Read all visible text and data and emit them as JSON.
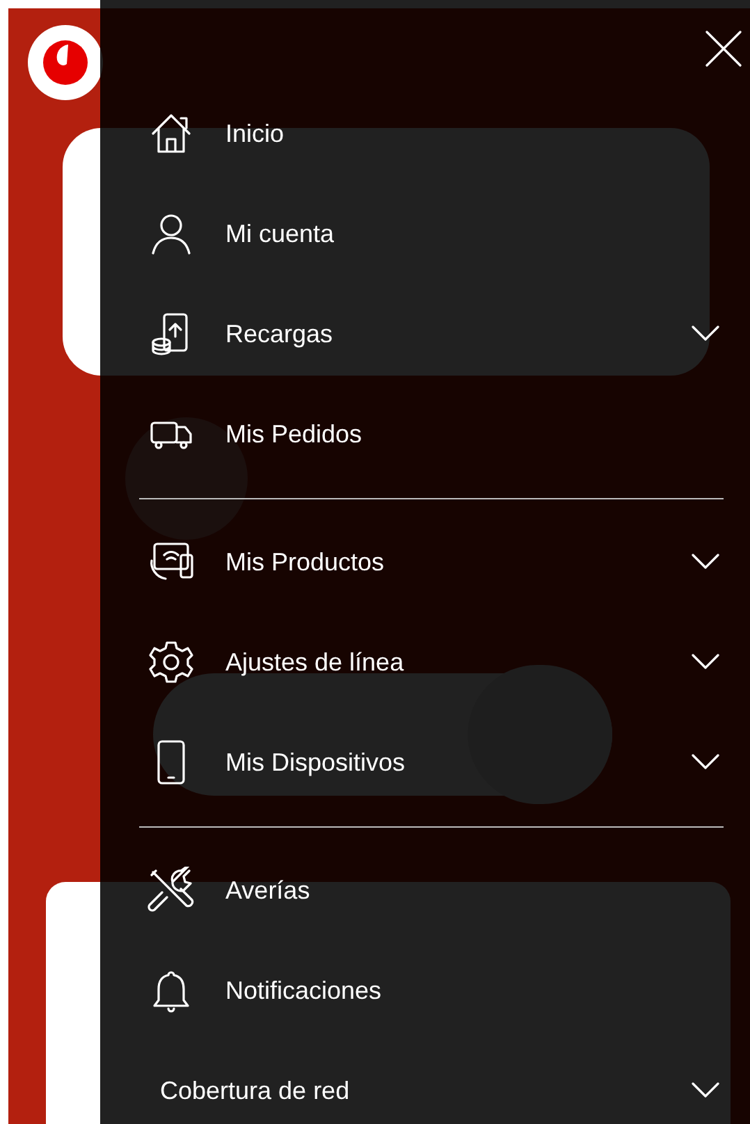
{
  "menu": {
    "sections": [
      {
        "items": [
          {
            "label": "Inicio",
            "expandable": false
          },
          {
            "label": "Mi cuenta",
            "expandable": false
          },
          {
            "label": "Recargas",
            "expandable": true
          },
          {
            "label": "Mis Pedidos",
            "expandable": false
          }
        ]
      },
      {
        "items": [
          {
            "label": "Mis Productos",
            "expandable": true
          },
          {
            "label": "Ajustes de línea",
            "expandable": true
          },
          {
            "label": "Mis Dispositivos",
            "expandable": true
          }
        ]
      },
      {
        "items": [
          {
            "label": "Averías",
            "expandable": false
          },
          {
            "label": "Notificaciones",
            "expandable": false
          },
          {
            "label": "Cobertura de red",
            "expandable": true
          }
        ]
      }
    ]
  }
}
